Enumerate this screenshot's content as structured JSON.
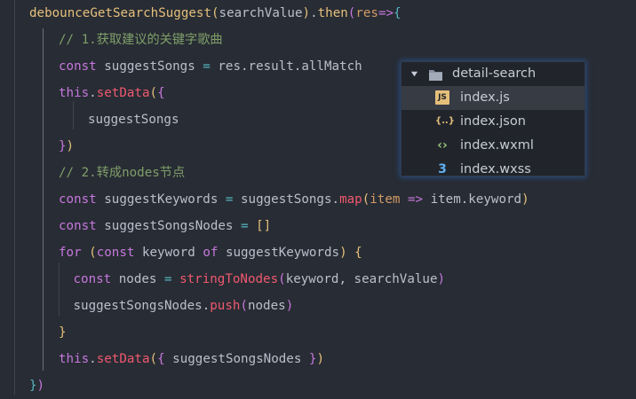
{
  "editor": {
    "lines": [
      {
        "indent": 0,
        "tokens": [
          {
            "t": "debounceGetSearchSuggest",
            "c": "fn"
          },
          {
            "t": "(",
            "c": "br1"
          },
          {
            "t": "searchValue",
            "c": "var"
          },
          {
            "t": ")",
            "c": "br1"
          },
          {
            "t": ".",
            "c": "var"
          },
          {
            "t": "then",
            "c": "fn"
          },
          {
            "t": "(",
            "c": "br2"
          },
          {
            "t": "res",
            "c": "param"
          },
          {
            "t": "=>",
            "c": "kw"
          },
          {
            "t": "{",
            "c": "br3"
          }
        ]
      },
      {
        "indent": 1,
        "tokens": [
          {
            "t": "// 1.获取建议的关键字歌曲",
            "c": "comment"
          }
        ]
      },
      {
        "indent": 1,
        "tokens": [
          {
            "t": "const ",
            "c": "kw"
          },
          {
            "t": "suggestSongs ",
            "c": "var"
          },
          {
            "t": "= ",
            "c": "op"
          },
          {
            "t": "res.result.allMatch",
            "c": "var"
          }
        ]
      },
      {
        "indent": 1,
        "tokens": [
          {
            "t": "this",
            "c": "this"
          },
          {
            "t": ".",
            "c": "var"
          },
          {
            "t": "setData",
            "c": "fn2"
          },
          {
            "t": "(",
            "c": "br1"
          },
          {
            "t": "{",
            "c": "br2"
          }
        ]
      },
      {
        "indent": 2,
        "tokens": [
          {
            "t": "suggestSongs",
            "c": "var"
          }
        ]
      },
      {
        "indent": 1,
        "tokens": [
          {
            "t": "}",
            "c": "br2"
          },
          {
            "t": ")",
            "c": "br1"
          }
        ]
      },
      {
        "indent": 1,
        "tokens": [
          {
            "t": "// 2.转成nodes节点",
            "c": "comment"
          }
        ]
      },
      {
        "indent": 1,
        "tokens": [
          {
            "t": "const ",
            "c": "kw"
          },
          {
            "t": "suggestKeywords ",
            "c": "var"
          },
          {
            "t": "= ",
            "c": "op"
          },
          {
            "t": "suggestSongs.",
            "c": "var"
          },
          {
            "t": "map",
            "c": "fn2"
          },
          {
            "t": "(",
            "c": "br1"
          },
          {
            "t": "item ",
            "c": "param"
          },
          {
            "t": "=> ",
            "c": "kw"
          },
          {
            "t": "item.keyword",
            "c": "var"
          },
          {
            "t": ")",
            "c": "br1"
          }
        ]
      },
      {
        "indent": 1,
        "tokens": [
          {
            "t": "const ",
            "c": "kw"
          },
          {
            "t": "suggestSongsNodes ",
            "c": "var"
          },
          {
            "t": "= ",
            "c": "op"
          },
          {
            "t": "[]",
            "c": "br1"
          }
        ]
      },
      {
        "indent": 1,
        "tokens": [
          {
            "t": "for ",
            "c": "kw"
          },
          {
            "t": "(",
            "c": "br1"
          },
          {
            "t": "const ",
            "c": "kw"
          },
          {
            "t": "keyword ",
            "c": "var"
          },
          {
            "t": "of ",
            "c": "kw"
          },
          {
            "t": "suggestKeywords",
            "c": "var"
          },
          {
            "t": ") ",
            "c": "br1"
          },
          {
            "t": "{",
            "c": "br1"
          }
        ]
      },
      {
        "indent": 1.5,
        "tokens": [
          {
            "t": "const ",
            "c": "kw"
          },
          {
            "t": "nodes ",
            "c": "var"
          },
          {
            "t": "= ",
            "c": "op"
          },
          {
            "t": "stringToNodes",
            "c": "fn2"
          },
          {
            "t": "(",
            "c": "br2"
          },
          {
            "t": "keyword, searchValue",
            "c": "var"
          },
          {
            "t": ")",
            "c": "br2"
          }
        ]
      },
      {
        "indent": 1.5,
        "tokens": [
          {
            "t": "suggestSongsNodes.",
            "c": "var"
          },
          {
            "t": "push",
            "c": "fn2"
          },
          {
            "t": "(",
            "c": "br2"
          },
          {
            "t": "nodes",
            "c": "var"
          },
          {
            "t": ")",
            "c": "br2"
          }
        ]
      },
      {
        "indent": 1,
        "tokens": [
          {
            "t": "}",
            "c": "br1"
          }
        ]
      },
      {
        "indent": 1,
        "tokens": [
          {
            "t": "this",
            "c": "this"
          },
          {
            "t": ".",
            "c": "var"
          },
          {
            "t": "setData",
            "c": "fn2"
          },
          {
            "t": "(",
            "c": "br1"
          },
          {
            "t": "{ ",
            "c": "br2"
          },
          {
            "t": "suggestSongsNodes ",
            "c": "var"
          },
          {
            "t": "}",
            "c": "br2"
          },
          {
            "t": ")",
            "c": "br1"
          }
        ]
      },
      {
        "indent": 0,
        "tokens": [
          {
            "t": "}",
            "c": "br3"
          },
          {
            "t": ")",
            "c": "br2"
          }
        ]
      }
    ]
  },
  "file_tree": {
    "folder": {
      "name": "detail-search",
      "expanded": true
    },
    "files": [
      {
        "name": "index.js",
        "icon": "js-file-icon",
        "badge": "JS",
        "color": "#e5c07b",
        "selected": true
      },
      {
        "name": "index.json",
        "icon": "json-file-icon",
        "badge": "{..}",
        "color": "#e5c07b",
        "selected": false
      },
      {
        "name": "index.wxml",
        "icon": "wxml-file-icon",
        "badge": "‹›",
        "color": "#98c379",
        "selected": false
      },
      {
        "name": "index.wxss",
        "icon": "wxss-file-icon",
        "badge": "3",
        "color": "#61afef",
        "selected": false
      }
    ]
  }
}
